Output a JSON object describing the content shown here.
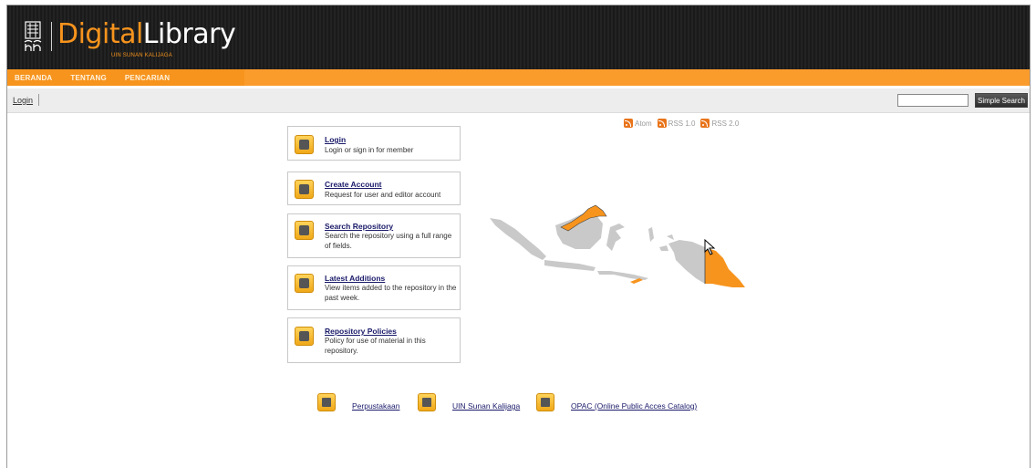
{
  "header": {
    "logo_digital": "Digital",
    "logo_library": "Library",
    "logo_subtitle": "UIN SUNAN KALIJAGA",
    "logo_icon": "uin-emblem-icon"
  },
  "nav": {
    "items": [
      {
        "label": "BERANDA"
      },
      {
        "label": "TENTANG"
      },
      {
        "label": "PENCARIAN"
      }
    ]
  },
  "loginbar": {
    "login_label": "Login",
    "search_value": "",
    "search_button": "Simple Search"
  },
  "feeds": [
    {
      "label": "Atom",
      "icon": "rss-icon"
    },
    {
      "label": "RSS 1.0",
      "icon": "rss-icon"
    },
    {
      "label": "RSS 2.0",
      "icon": "rss-icon"
    }
  ],
  "menu": [
    {
      "title": "Login",
      "desc": "Login or sign in for member",
      "icon": "lock-icon"
    },
    {
      "title": "Create Account",
      "desc": "Request for user and editor account",
      "icon": "user-icon"
    },
    {
      "title": "Search Repository",
      "desc": "Search the repository using a full range of fields.",
      "icon": "magnifier-icon"
    },
    {
      "title": "Latest Additions",
      "desc": "View items added to the repository in the past week.",
      "icon": "star-icon"
    },
    {
      "title": "Repository Policies",
      "desc": "Policy for use of material in this repository.",
      "icon": "policy-icon"
    }
  ],
  "footer": [
    {
      "label": "Perpustakaan",
      "icon": "library-icon"
    },
    {
      "label": "UIN Sunan Kalijaga",
      "icon": "university-icon"
    },
    {
      "label": "OPAC (Online Public Acces Catalog)",
      "icon": "catalog-icon"
    }
  ],
  "colors": {
    "accent": "#f7941d",
    "header_bg": "#1e1e1e",
    "link": "#1a1a6a",
    "map_grey": "#c9c9c9",
    "map_orange": "#f7941d"
  }
}
